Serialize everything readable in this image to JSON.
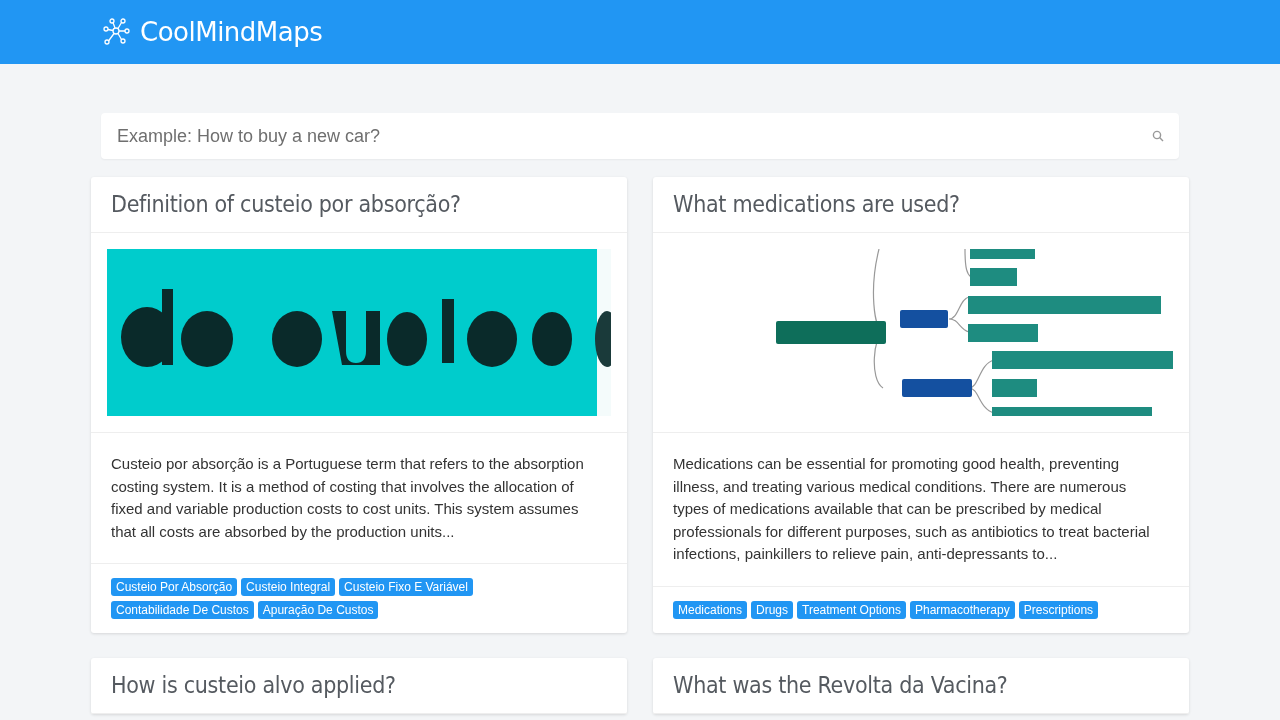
{
  "header": {
    "brand": "CoolMindMaps"
  },
  "search": {
    "placeholder": "Example: How to buy a new car?"
  },
  "cards": [
    {
      "title": "Definition of custeio por absorção?",
      "summary": "Custeio por absorção is a Portuguese term that refers to the absorption costing system. It is a method of costing that involves the allocation of fixed and variable production costs to cost units. This system assumes that all costs are absorbed by the production units...",
      "tags": [
        "Custeio Por Absorção",
        "Custeio Integral",
        "Custeio Fixo E Variável",
        "Contabilidade De Custos",
        "Apuração De Custos"
      ]
    },
    {
      "title": "What medications are used?",
      "summary": "Medications can be essential for promoting good health, preventing illness, and treating various medical conditions. There are numerous types of medications available that can be prescribed by medical professionals for different purposes, such as antibiotics to treat bacterial infections, painkillers to relieve pain, anti-depressants to...",
      "tags": [
        "Medications",
        "Drugs",
        "Treatment Options",
        "Pharmacotherapy",
        "Prescriptions"
      ]
    },
    {
      "title": "How is custeio alvo applied?"
    },
    {
      "title": "What was the Revolta da Vacina?"
    }
  ]
}
